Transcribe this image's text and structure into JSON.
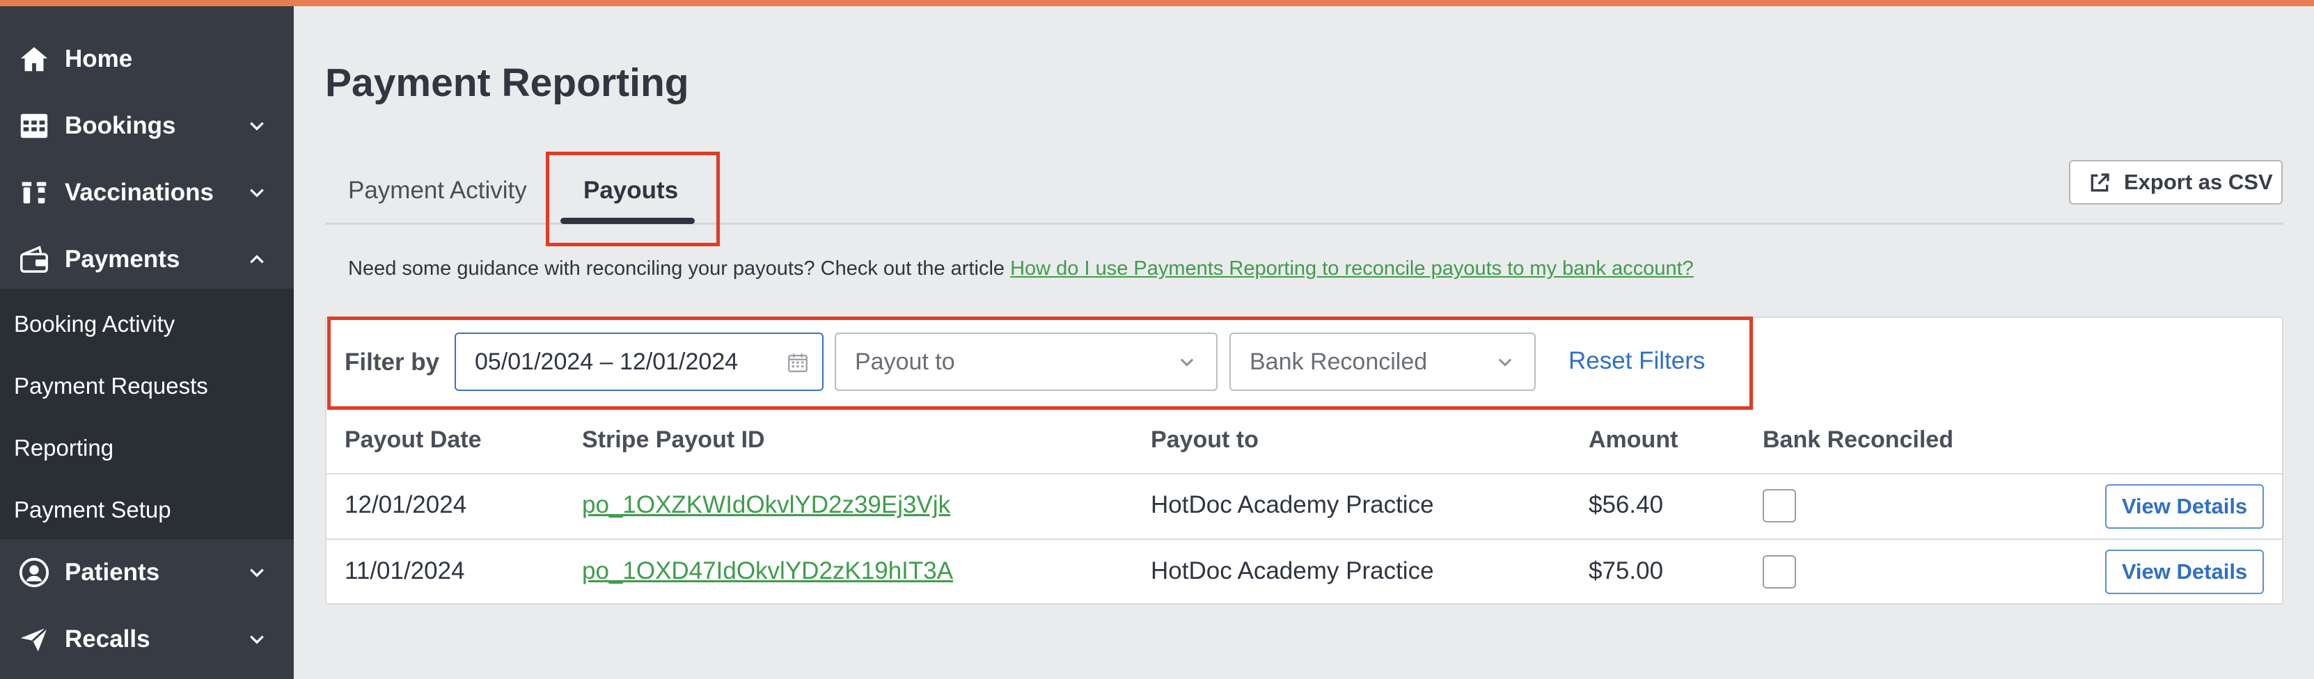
{
  "colors": {
    "accent_bar": "#e67e52",
    "sidebar": "#363b44",
    "link_green": "#3f9c4c",
    "link_blue": "#2f6fc8",
    "highlight": "#e23b24"
  },
  "sidebar": {
    "items": [
      {
        "label": "Home",
        "icon": "home-icon"
      },
      {
        "label": "Bookings",
        "icon": "calendar-grid-icon"
      },
      {
        "label": "Vaccinations",
        "icon": "vials-icon"
      },
      {
        "label": "Payments",
        "icon": "wallet-icon"
      },
      {
        "label": "Patients",
        "icon": "user-circle-icon"
      },
      {
        "label": "Recalls",
        "icon": "paper-plane-icon"
      }
    ],
    "payments_subitems": [
      "Booking Activity",
      "Payment Requests",
      "Reporting",
      "Payment Setup"
    ]
  },
  "page": {
    "title": "Payment Reporting"
  },
  "tabs": [
    {
      "label": "Payment Activity",
      "active": false
    },
    {
      "label": "Payouts",
      "active": true
    }
  ],
  "export": {
    "label": "Export as CSV",
    "icon": "external-link-icon"
  },
  "guidance": {
    "text": "Need some guidance with reconciling your payouts? Check out the article ",
    "link_text": "How do I use Payments Reporting to reconcile payouts to my bank account?"
  },
  "filters": {
    "label": "Filter by",
    "date_range": "05/01/2024 – 12/01/2024",
    "payout_to_placeholder": "Payout to",
    "bank_reconciled_placeholder": "Bank Reconciled",
    "reset_label": "Reset Filters"
  },
  "table": {
    "headers": [
      "Payout Date",
      "Stripe Payout ID",
      "Payout to",
      "Amount",
      "Bank Reconciled"
    ],
    "rows": [
      {
        "date": "12/01/2024",
        "payout_id": "po_1OXZKWIdOkvlYD2z39Ej3Vjk",
        "payout_to": "HotDoc Academy Practice",
        "amount": "$56.40",
        "reconciled": false,
        "action": "View Details"
      },
      {
        "date": "11/01/2024",
        "payout_id": "po_1OXD47IdOkvlYD2zK19hIT3A",
        "payout_to": "HotDoc Academy Practice",
        "amount": "$75.00",
        "reconciled": false,
        "action": "View Details"
      }
    ]
  }
}
